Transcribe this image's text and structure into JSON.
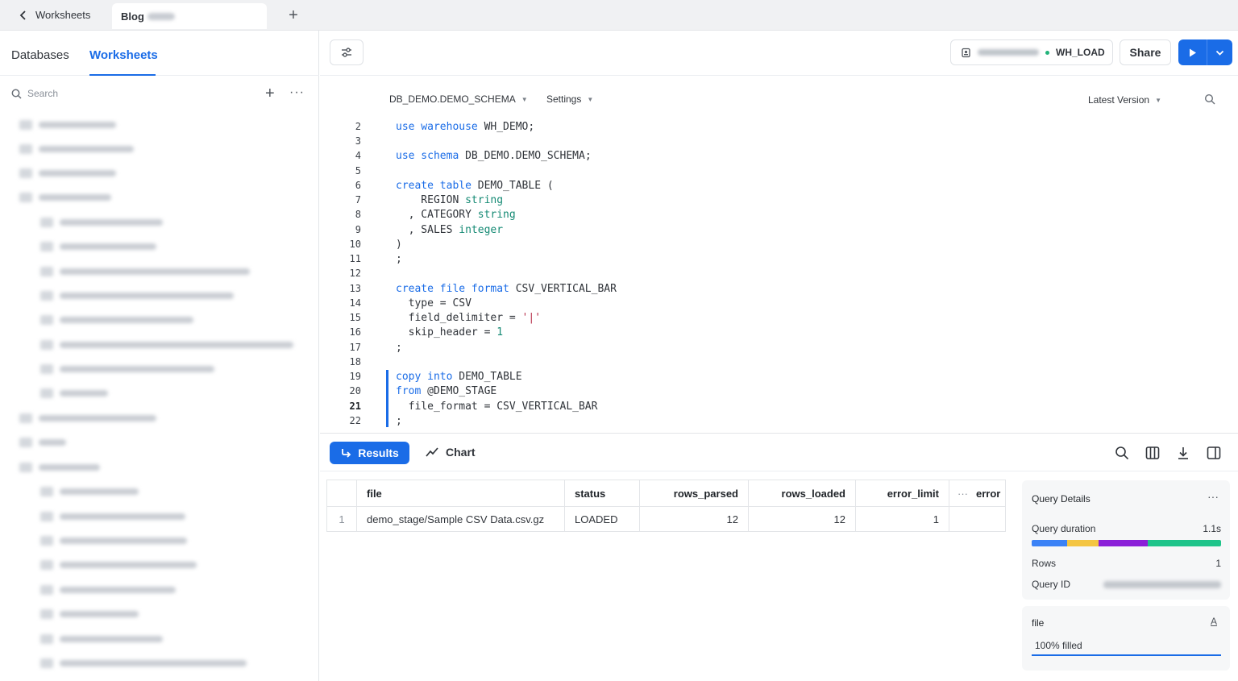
{
  "tabs": {
    "back_label": "Worksheets",
    "active_tab": "Blog",
    "new_tab_icon": "plus-icon"
  },
  "sidebar": {
    "tabs": [
      "Databases",
      "Worksheets"
    ],
    "search_placeholder": "Search"
  },
  "header": {
    "warehouse": "WH_LOAD",
    "share_label": "Share"
  },
  "editor": {
    "context": "DB_DEMO.DEMO_SCHEMA",
    "settings": "Settings",
    "version": "Latest Version",
    "current_line": 21
  },
  "results": {
    "results_label": "Results",
    "chart_label": "Chart",
    "columns": [
      "file",
      "status",
      "rows_parsed",
      "rows_loaded",
      "error_limit",
      "error"
    ],
    "rows": [
      {
        "index": "1",
        "file": "demo_stage/Sample CSV Data.csv.gz",
        "status": "LOADED",
        "rows_parsed": "12",
        "rows_loaded": "12",
        "error_limit": "1"
      }
    ]
  },
  "query_details": {
    "title": "Query Details",
    "duration_label": "Query duration",
    "duration_value": "1.1s",
    "duration_segments": [
      "#3b82f6",
      "#f4c542",
      "#8b1fd8",
      "#1fc48a"
    ],
    "rows_label": "Rows",
    "rows_value": "1",
    "id_label": "Query ID"
  },
  "column_card": {
    "name": "file",
    "type_icon": "A",
    "fill": "100% filled"
  },
  "accent": "#1a6ce7"
}
